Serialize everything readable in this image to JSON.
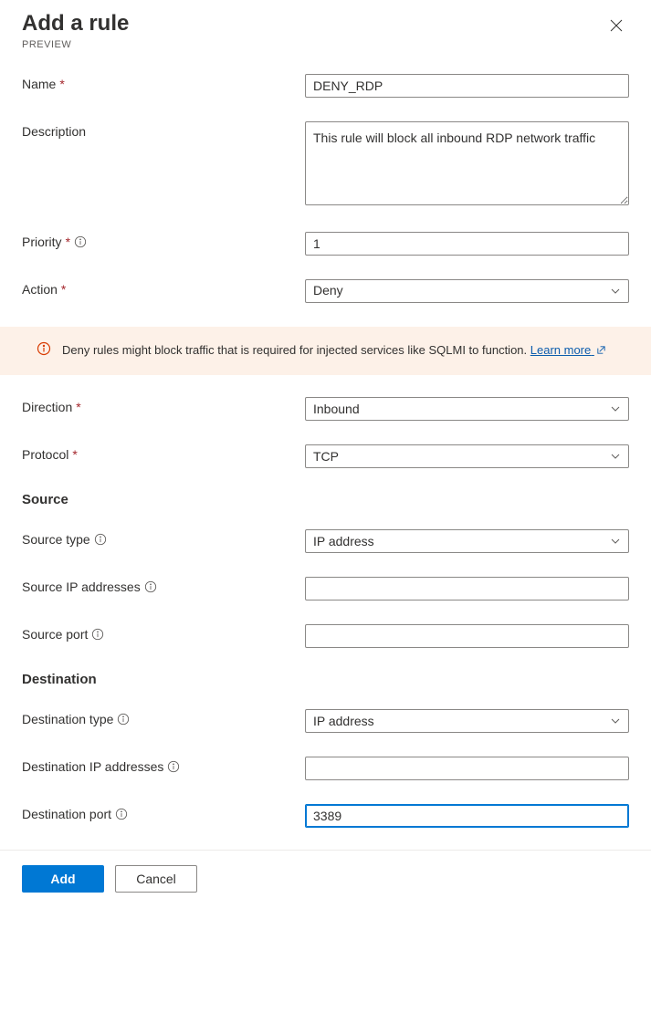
{
  "header": {
    "title": "Add a rule",
    "subtitle": "PREVIEW"
  },
  "labels": {
    "name": "Name",
    "description": "Description",
    "priority": "Priority",
    "action": "Action",
    "direction": "Direction",
    "protocol": "Protocol",
    "source_section": "Source",
    "source_type": "Source type",
    "source_ip": "Source IP addresses",
    "source_port": "Source port",
    "destination_section": "Destination",
    "destination_type": "Destination type",
    "destination_ip": "Destination IP addresses",
    "destination_port": "Destination port"
  },
  "values": {
    "name": "DENY_RDP",
    "description": "This rule will block all inbound RDP network traffic",
    "priority": "1",
    "action": "Deny",
    "direction": "Inbound",
    "protocol": "TCP",
    "source_type": "IP address",
    "source_ip": "",
    "source_port": "",
    "destination_type": "IP address",
    "destination_ip": "",
    "destination_port": "3389"
  },
  "warning": {
    "text": "Deny rules might block traffic that is required for injected services like SQLMI to function. ",
    "link_text": "Learn more"
  },
  "footer": {
    "add": "Add",
    "cancel": "Cancel"
  }
}
